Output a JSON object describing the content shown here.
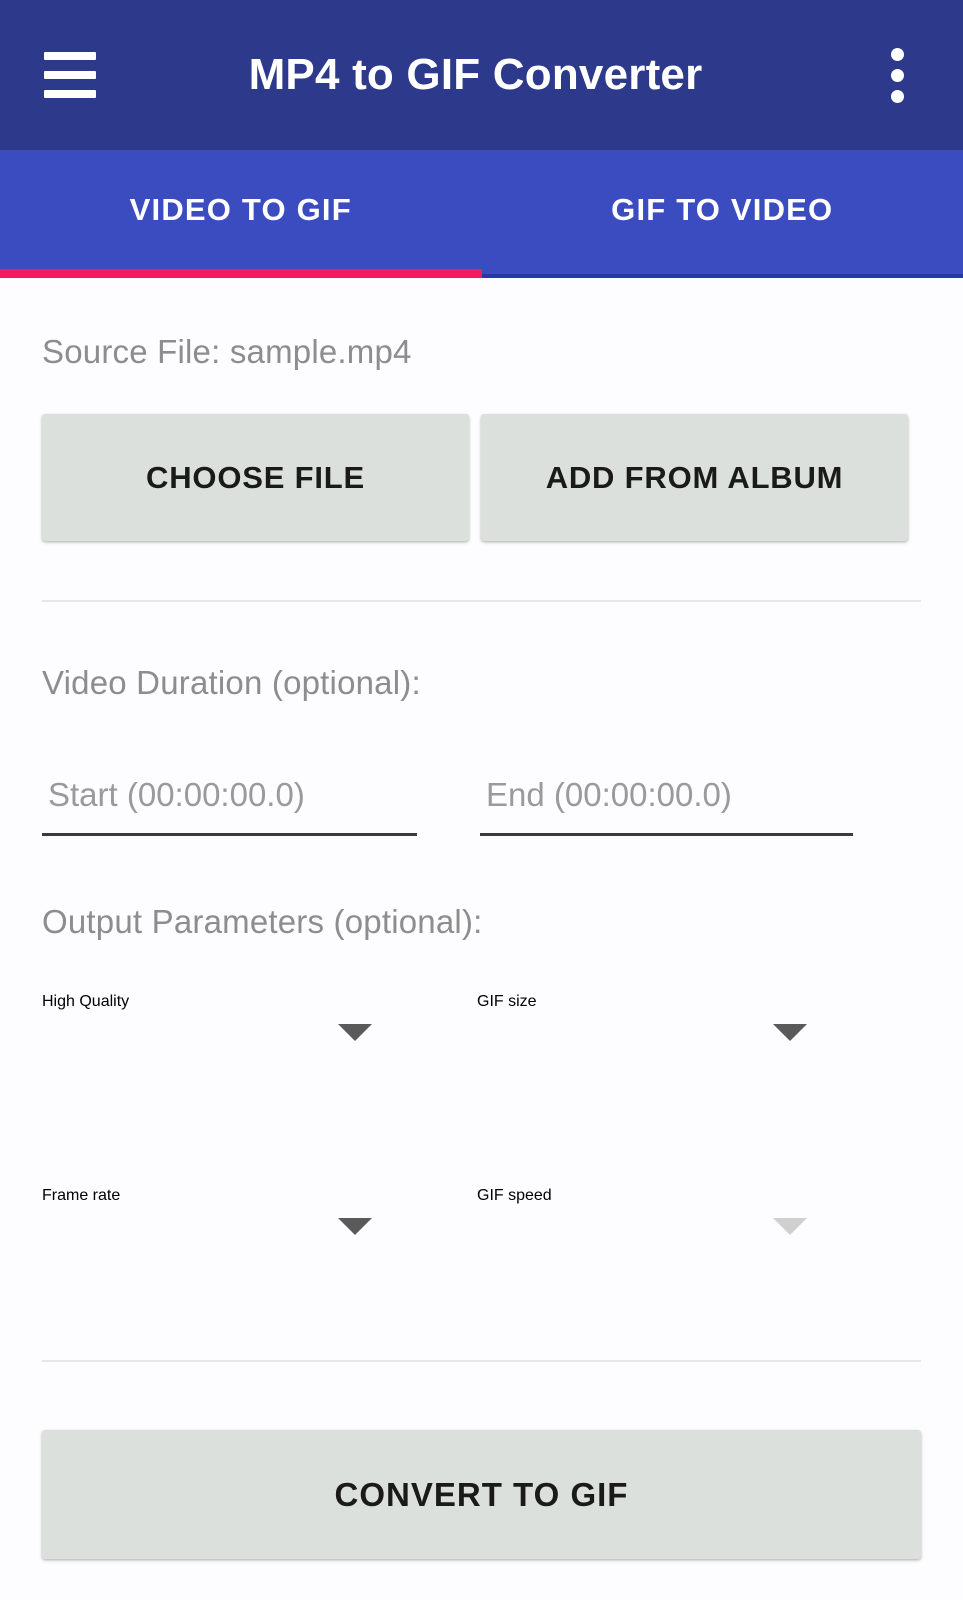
{
  "appbar": {
    "title": "MP4 to GIF Converter",
    "menu_icon": "hamburger-menu-icon",
    "overflow_icon": "more-vert-icon",
    "background_color": "#2D3A8C"
  },
  "tabs": {
    "items": [
      {
        "label": "VIDEO TO GIF",
        "selected": true
      },
      {
        "label": "GIF TO VIDEO",
        "selected": false
      }
    ],
    "indicator_color": "#F01B60",
    "background_color": "#3B4CC0"
  },
  "source": {
    "label": "Source File: sample.mp4"
  },
  "file_buttons": {
    "choose_file": "CHOOSE FILE",
    "add_from_album": "ADD FROM ALBUM",
    "background_color": "#DCE0DC"
  },
  "duration": {
    "label": "Video Duration (optional):",
    "start": {
      "value": "",
      "placeholder": "Start (00:00:00.0)"
    },
    "end": {
      "value": "",
      "placeholder": "End (00:00:00.0)"
    }
  },
  "output": {
    "label": "Output Parameters (optional):",
    "quality": {
      "value": "High Quality",
      "placeholder": "Quality",
      "focused": true
    },
    "gif_size": {
      "value": "",
      "placeholder": "GIF size",
      "focused": false
    },
    "frame_rate": {
      "value": "",
      "placeholder": "Frame rate",
      "focused": false
    },
    "gif_speed": {
      "value": "",
      "placeholder": "GIF speed",
      "focused": false,
      "disabled": true
    }
  },
  "action": {
    "convert": "CONVERT TO GIF"
  }
}
